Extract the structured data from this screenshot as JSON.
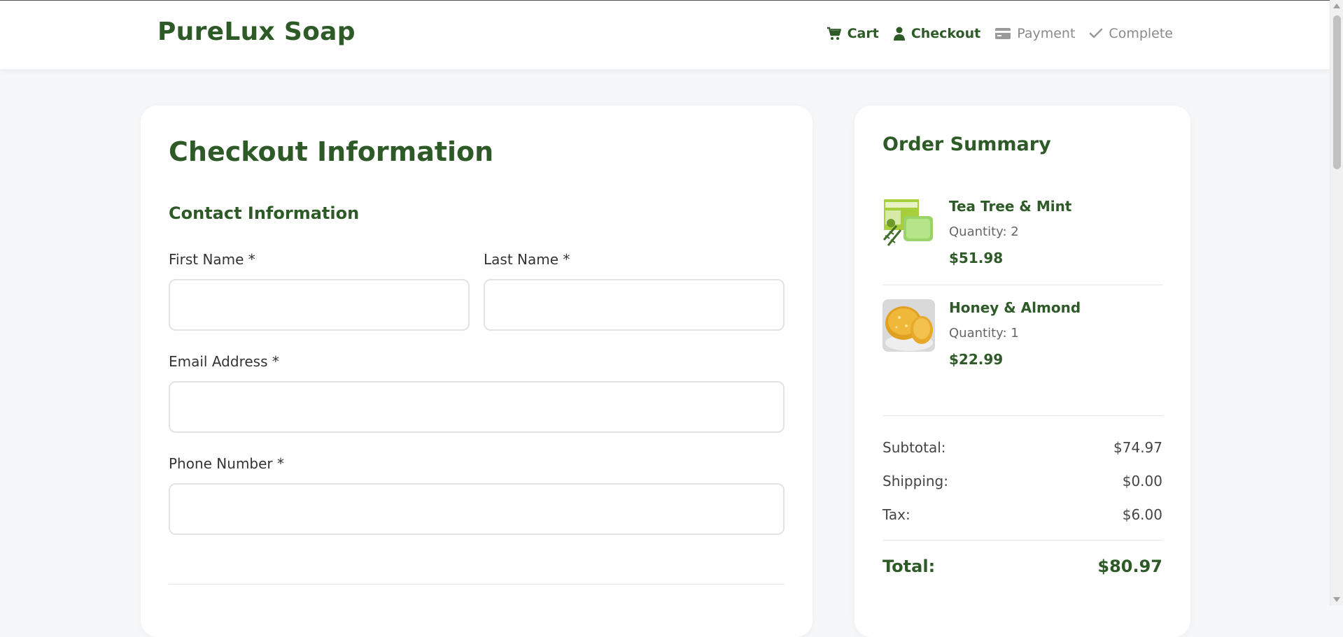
{
  "brand": {
    "name": "PureLux Soap",
    "color": "#2d5a27"
  },
  "steps": [
    {
      "label": "Cart",
      "icon": "cart-icon",
      "state": "active"
    },
    {
      "label": "Checkout",
      "icon": "user-icon",
      "state": "active"
    },
    {
      "label": "Payment",
      "icon": "credit-card-icon",
      "state": "inactive"
    },
    {
      "label": "Complete",
      "icon": "check-icon",
      "state": "inactive"
    }
  ],
  "checkout": {
    "title": "Checkout Information",
    "contact_title": "Contact Information",
    "first_name_label": "First Name *",
    "last_name_label": "Last Name *",
    "email_label": "Email Address *",
    "phone_label": "Phone Number *",
    "first_name_value": "",
    "last_name_value": "",
    "email_value": "",
    "phone_value": ""
  },
  "summary": {
    "title": "Order Summary",
    "items": [
      {
        "name": "Tea Tree & Mint",
        "quantity": "Quantity: 2",
        "price": "$51.98"
      },
      {
        "name": "Honey & Almond",
        "quantity": "Quantity: 1",
        "price": "$22.99"
      }
    ],
    "subtotal_label": "Subtotal:",
    "subtotal_value": "$74.97",
    "shipping_label": "Shipping:",
    "shipping_value": "$0.00",
    "tax_label": "Tax:",
    "tax_value": "$6.00",
    "total_label": "Total:",
    "total_value": "$80.97"
  }
}
